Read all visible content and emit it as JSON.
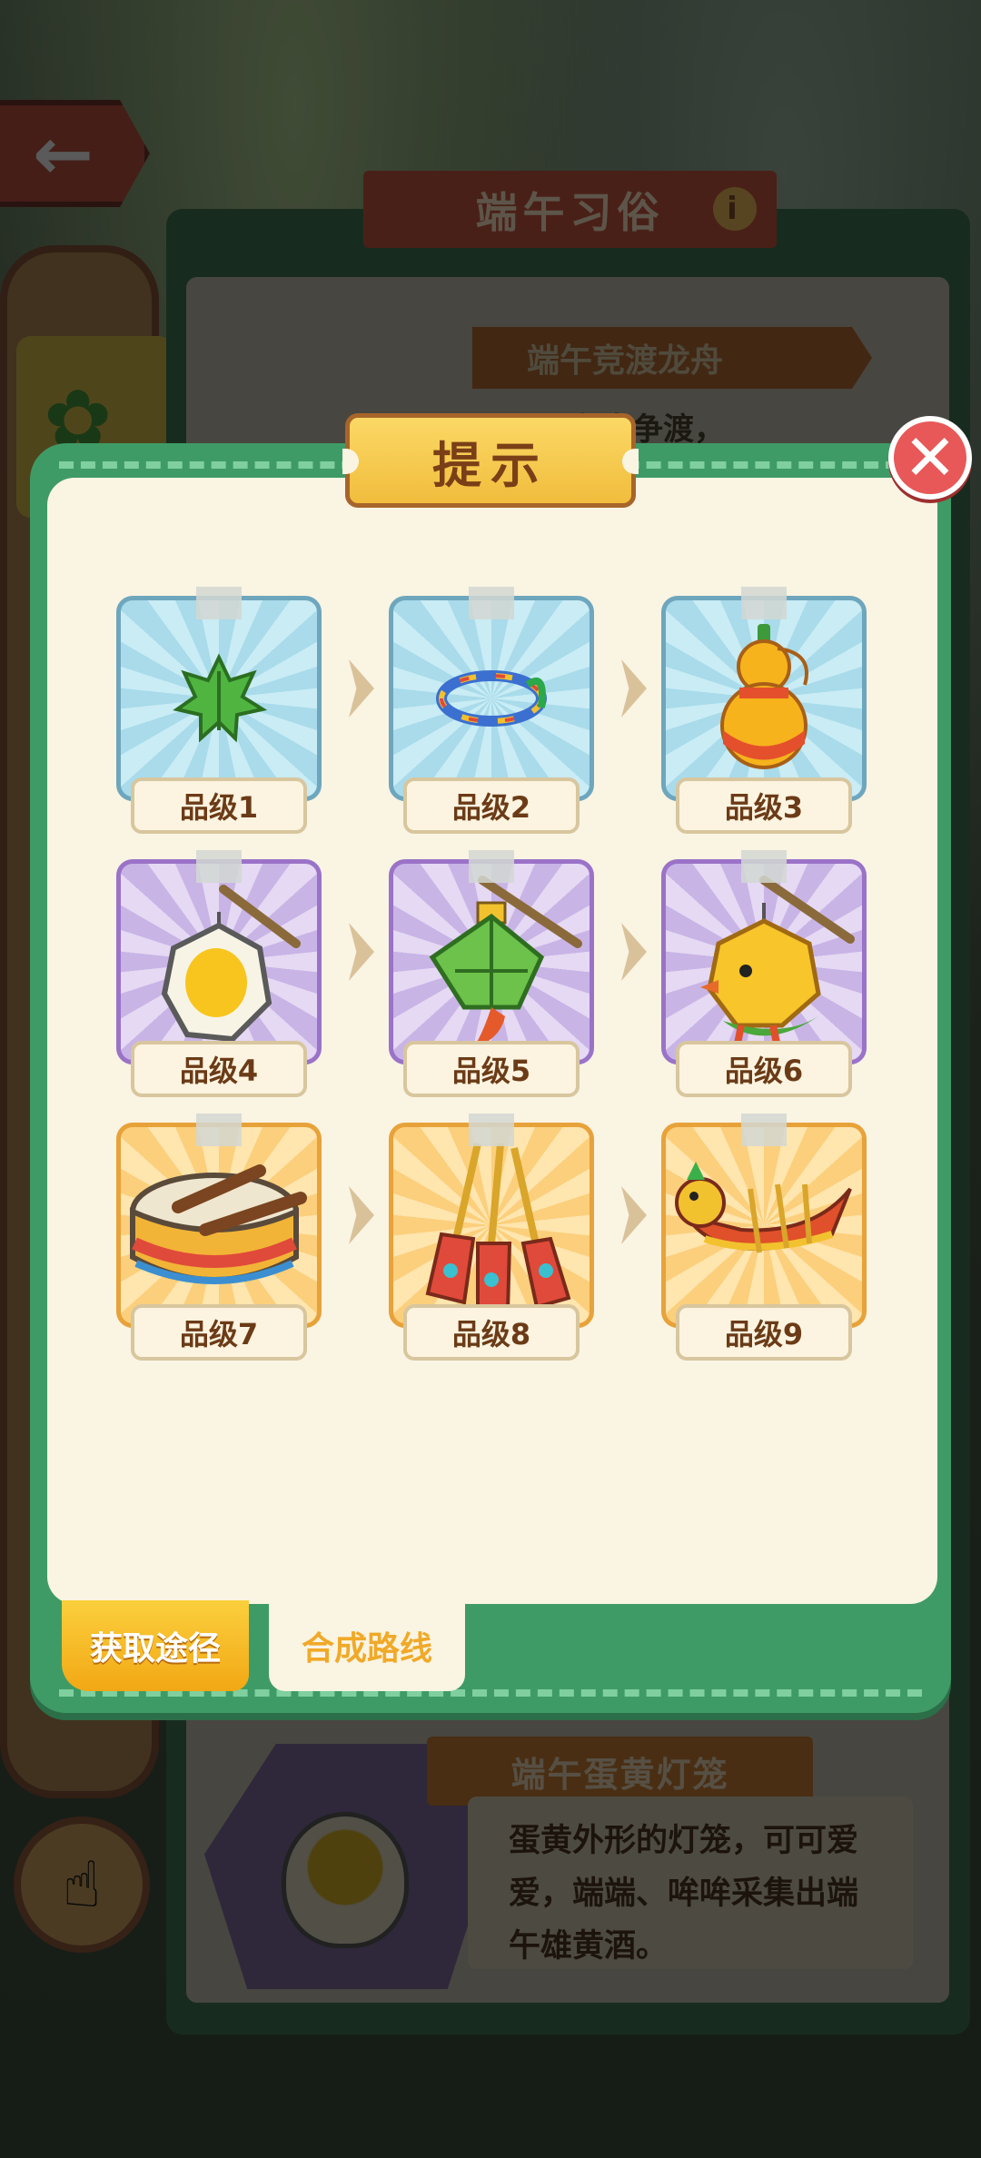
{
  "background": {
    "back_label": "←",
    "panel_title": "端午习俗",
    "panel_info_icon": "i",
    "subtitle": "端午竞渡龙舟",
    "fragment_text": "…，龙舟争渡，",
    "bottom_title": "端午蛋黄灯笼",
    "bottom_desc": "蛋黄外形的灯笼，可可爱爱，端端、哞哞采集出端午雄黄酒。"
  },
  "modal": {
    "title": "提示",
    "close_icon": "✕",
    "items": [
      {
        "label": "品级1",
        "tier": "blue",
        "icon": "leaf-icon"
      },
      {
        "label": "品级2",
        "tier": "blue",
        "icon": "bracelet-icon"
      },
      {
        "label": "品级3",
        "tier": "blue",
        "icon": "gourd-icon"
      },
      {
        "label": "品级4",
        "tier": "purple",
        "icon": "egg-lantern-icon"
      },
      {
        "label": "品级5",
        "tier": "purple",
        "icon": "zongzi-lantern-icon"
      },
      {
        "label": "品级6",
        "tier": "purple",
        "icon": "duck-lantern-icon"
      },
      {
        "label": "品级7",
        "tier": "orange",
        "icon": "drum-icon"
      },
      {
        "label": "品级8",
        "tier": "orange",
        "icon": "paddles-icon"
      },
      {
        "label": "品级9",
        "tier": "orange",
        "icon": "dragon-boat-icon"
      }
    ],
    "tabs": {
      "obtain": "获取途径",
      "route": "合成路线"
    }
  },
  "colors": {
    "modal_green": "#3f9b66",
    "paper": "#faf4e3",
    "title_gold": "#f1bd3d",
    "close_red": "#e85858"
  }
}
